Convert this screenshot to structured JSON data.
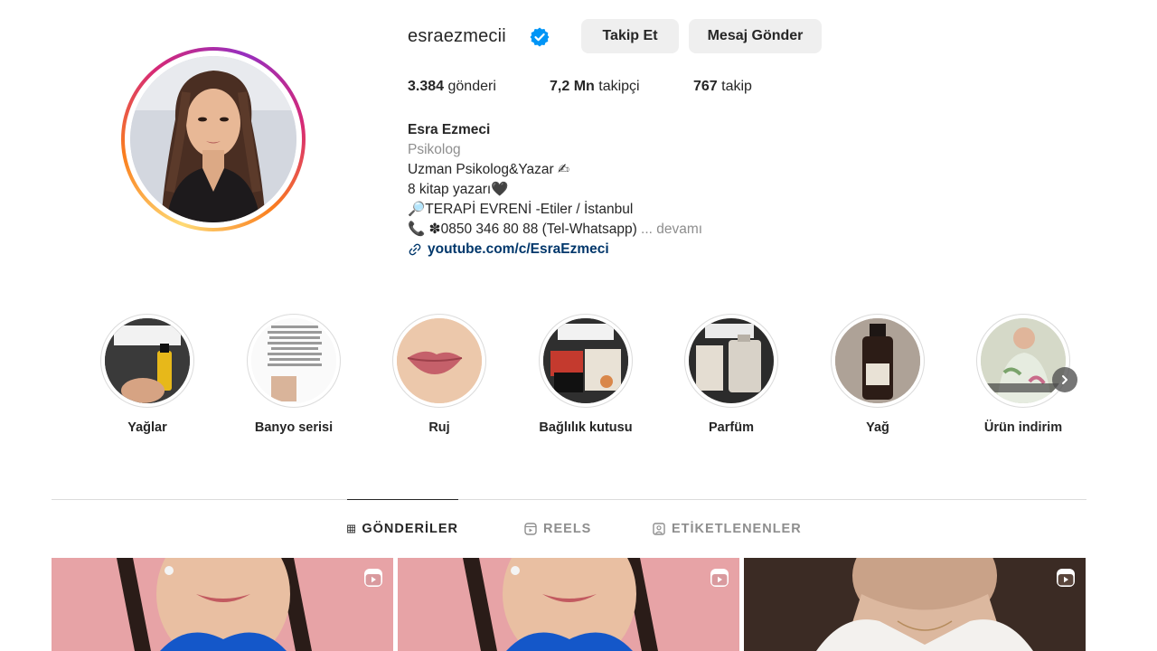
{
  "profile": {
    "username": "esraezmecii",
    "verified": true,
    "follow_label": "Takip Et",
    "message_label": "Mesaj Gönder",
    "stats": {
      "posts_value": "3.384",
      "posts_label": "gönderi",
      "followers_value": "7,2 Mn",
      "followers_label": "takipçi",
      "following_value": "767",
      "following_label": "takip"
    },
    "bio": {
      "name": "Esra Ezmeci",
      "category": "Psikolog",
      "lines": [
        "Uzman Psikolog&Yazar ✍",
        "8 kitap yazarı🖤",
        "🔎TERAPİ EVRENİ -Etiler / İstanbul",
        "📞 ✽0850 346 80 88 (Tel-Whatsapp)"
      ],
      "more_label": "... devamı",
      "link": "youtube.com/c/EsraEzmeci"
    }
  },
  "highlights": [
    {
      "label": "Yağlar",
      "icon": "oil-bottle-thumbnail"
    },
    {
      "label": "Banyo serisi",
      "icon": "text-post-thumbnail"
    },
    {
      "label": "Ruj",
      "icon": "lips-thumbnail"
    },
    {
      "label": "Bağlılık kutusu",
      "icon": "gift-box-thumbnail"
    },
    {
      "label": "Parfüm",
      "icon": "perfume-thumbnail"
    },
    {
      "label": "Yağ",
      "icon": "oil-bottle-thumbnail"
    },
    {
      "label": "Ürün indirim",
      "icon": "product-thumbnail"
    }
  ],
  "tabs": [
    {
      "label": "GÖNDERİLER",
      "icon": "grid-icon",
      "active": true
    },
    {
      "label": "REELS",
      "icon": "reels-icon",
      "active": false
    },
    {
      "label": "ETİKETLENENLER",
      "icon": "tagged-icon",
      "active": false
    }
  ],
  "colors": {
    "accent_link": "#00376b",
    "verified_blue": "#0095f6",
    "muted": "#8e8e8e",
    "button_bg": "#efefef"
  }
}
